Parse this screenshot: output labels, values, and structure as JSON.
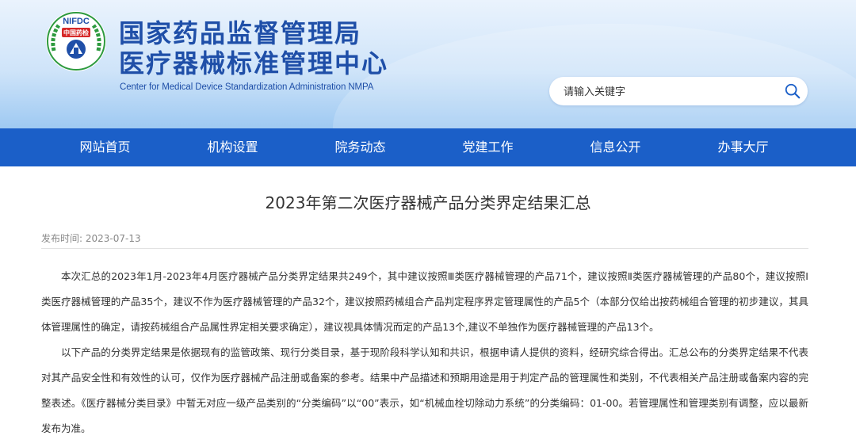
{
  "header": {
    "logo_text": "NIFDC 中国药检",
    "title_line1": "国家药品监督管理局",
    "title_line2": "医疗器械标准管理中心",
    "title_en": "Center for Medical Device Standardization Administration NMPA"
  },
  "search": {
    "placeholder": "请输入关键字"
  },
  "nav": {
    "items": [
      {
        "label": "网站首页"
      },
      {
        "label": "机构设置"
      },
      {
        "label": "院务动态"
      },
      {
        "label": "党建工作"
      },
      {
        "label": "信息公开"
      },
      {
        "label": "办事大厅"
      }
    ]
  },
  "article": {
    "title": "2023年第二次医疗器械产品分类界定结果汇总",
    "meta_label": "发布时间:",
    "date": "2023-07-13",
    "paragraphs": [
      "本次汇总的2023年1月-2023年4月医疗器械产品分类界定结果共249个，其中建议按照Ⅲ类医疗器械管理的产品71个，建议按照Ⅱ类医疗器械管理的产品80个，建议按照Ⅰ类医疗器械管理的产品35个，建议不作为医疗器械管理的产品32个，建议按照药械组合产品判定程序界定管理属性的产品5个（本部分仅给出按药械组合管理的初步建议，其具体管理属性的确定，请按药械组合产品属性界定相关要求确定），建议视具体情况而定的产品13个,建议不单独作为医疗器械管理的产品13个。",
      "以下产品的分类界定结果是依据现有的监管政策、现行分类目录，基于现阶段科学认知和共识，根据申请人提供的资料，经研究综合得出。汇总公布的分类界定结果不代表对其产品安全性和有效性的认可，仅作为医疗器械产品注册或备案的参考。结果中产品描述和预期用途是用于判定产品的管理属性和类别，不代表相关产品注册或备案内容的完整表述。《医疗器械分类目录》中暂无对应一级产品类别的“分类编码”以“00”表示，如“机械血栓切除动力系统”的分类编码：01-00。若管理属性和管理类别有调整，应以最新发布为准。"
    ]
  }
}
